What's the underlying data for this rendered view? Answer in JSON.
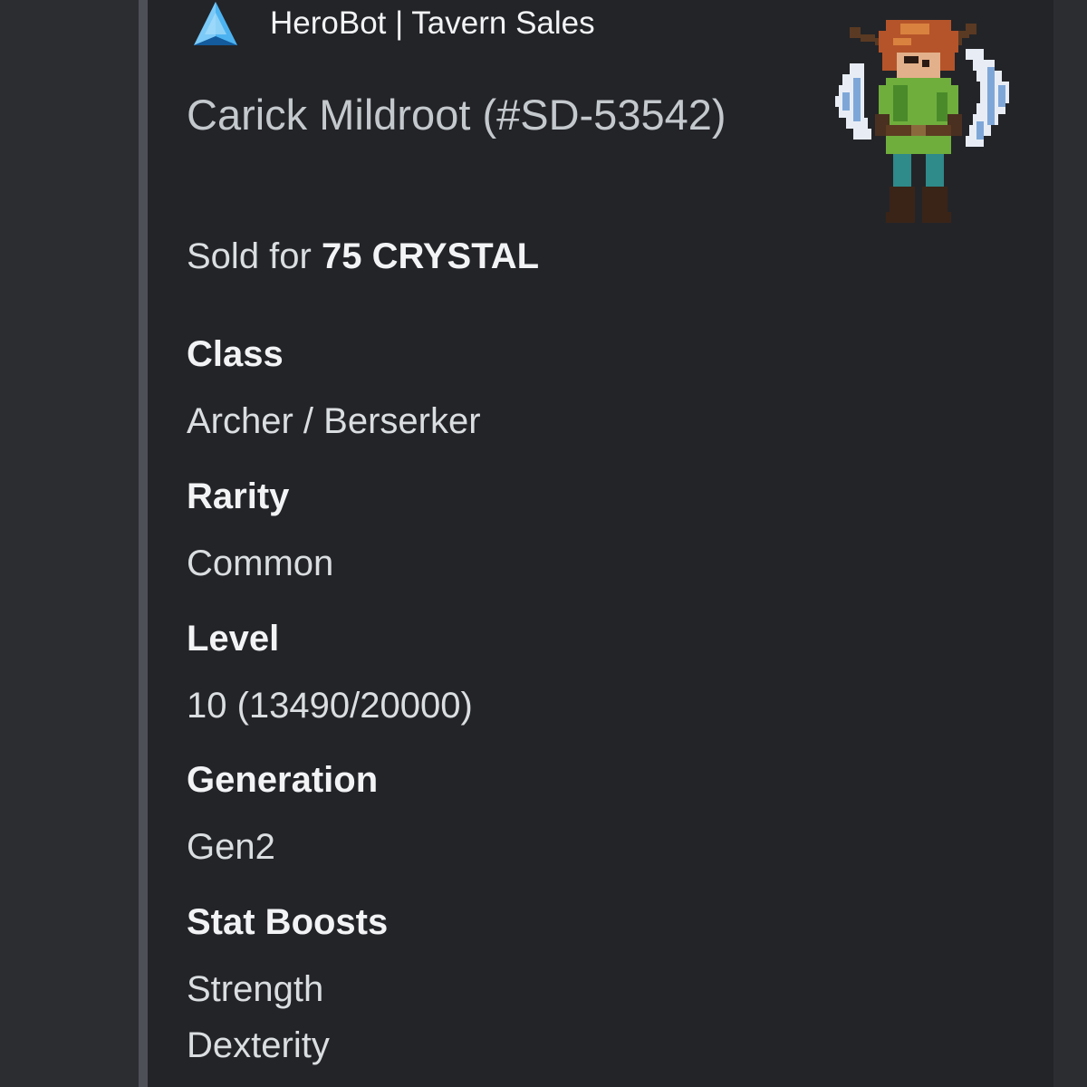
{
  "embed": {
    "author": {
      "name": "HeroBot | Tavern Sales",
      "icon": "crystal-triangle-icon"
    },
    "title": "Carick Mildroot (#SD-53542)",
    "sold_prefix": "Sold for",
    "sold_amount": "75 CRYSTAL",
    "thumbnail": "pixel-art-hero-archer-with-wings",
    "fields": [
      {
        "name": "Class",
        "values": [
          "Archer / Berserker"
        ]
      },
      {
        "name": "Rarity",
        "values": [
          "Common"
        ]
      },
      {
        "name": "Level",
        "values": [
          "10 (13490/20000)"
        ]
      },
      {
        "name": "Generation",
        "values": [
          "Gen2"
        ]
      },
      {
        "name": "Stat Boosts",
        "values": [
          "Strength",
          "Dexterity"
        ]
      }
    ]
  },
  "colors": {
    "background": "#2b2d31",
    "embed_background": "#232428",
    "accent_bar": "#4e5058",
    "crystal": "#3aa0e0"
  }
}
